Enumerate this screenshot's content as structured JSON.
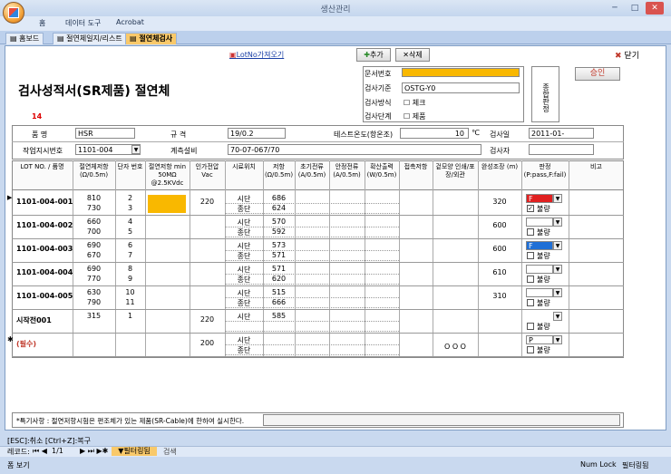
{
  "app": {
    "title": "생산관리",
    "ribbon_tabs": [
      "홈",
      "데이터 도구",
      "Acrobat"
    ]
  },
  "doc_tabs": [
    "홈보드",
    "절연체일지/리스트",
    "절연체검사"
  ],
  "toolbar": {
    "load_link": "LotNo가져오기",
    "add": "추가",
    "delete": "삭제",
    "close": "닫기"
  },
  "approval": {
    "doc_no_label": "문서번호",
    "standard_label": "검사기준",
    "standard_value": "OSTG-Y0",
    "method_label": "검사방식",
    "stage_label": "검사단계",
    "check": "체크",
    "product": "제품",
    "judge_label": "종합판정",
    "approve_btn": "승인"
  },
  "form_title": "검사성적서(SR제품) 절연체",
  "red_number": "14",
  "header": {
    "product_label": "품 명",
    "product": "HSR",
    "spec_label": "규 격",
    "spec": "19/0.2",
    "test_temp_label": "테스트온도(항온조)",
    "temp_value": "10",
    "temp_unit": "℃",
    "date_label": "검사일",
    "date": "2011-01-",
    "work_label": "작업지시번호",
    "work_no": "1101-004",
    "equip_label": "계측설비",
    "equip": "70-07-067/70",
    "inspector_label": "검사자"
  },
  "columns": [
    "LOT NO. / 품명",
    "절연체저항 (Ω/0.5m)",
    "단자 번호",
    "절연저항 min 50MΩ @2.5KVdc",
    "인가전압 Vac",
    "시료위치",
    "저항 (Ω/0.5m)",
    "초기전류 (A/0.5m)",
    "안정전류 (A/0.5m)",
    "확산출력 (W/0.5m)",
    "접촉저항",
    "겉모양 인쇄/포장/외관",
    "완성조장 (m)",
    "판정 (P:pass,F:fail)",
    "비고"
  ],
  "rows": [
    {
      "lot": "1101-004-001",
      "r": [
        "810",
        "730"
      ],
      "t": [
        "2",
        "3"
      ],
      "yellow": true,
      "v": "220",
      "pos": [
        "시단",
        "종단"
      ],
      "ohm": [
        "686",
        "624"
      ],
      "app": "",
      "len": "320",
      "judge": "F",
      "judge_color": "red",
      "bad": "불량",
      "bad_checked": true
    },
    {
      "lot": "1101-004-002",
      "r": [
        "660",
        "700"
      ],
      "t": [
        "4",
        "5"
      ],
      "yellow": false,
      "v": "",
      "pos": [
        "시단",
        "종단"
      ],
      "ohm": [
        "570",
        "592"
      ],
      "app": "",
      "len": "600",
      "judge": "",
      "judge_color": "",
      "bad": "불량",
      "bad_checked": false
    },
    {
      "lot": "1101-004-003",
      "r": [
        "690",
        "670"
      ],
      "t": [
        "6",
        "7"
      ],
      "yellow": false,
      "v": "",
      "pos": [
        "시단",
        "종단"
      ],
      "ohm": [
        "573",
        "571"
      ],
      "app": "",
      "len": "600",
      "judge": "F",
      "judge_color": "blue",
      "bad": "불량",
      "bad_checked": false
    },
    {
      "lot": "1101-004-004",
      "r": [
        "690",
        "770"
      ],
      "t": [
        "8",
        "9"
      ],
      "yellow": false,
      "v": "",
      "pos": [
        "시단",
        "종단"
      ],
      "ohm": [
        "571",
        "620"
      ],
      "app": "",
      "len": "610",
      "judge": "",
      "judge_color": "",
      "bad": "불량",
      "bad_checked": false
    },
    {
      "lot": "1101-004-005",
      "r": [
        "630",
        "790"
      ],
      "t": [
        "10",
        "11"
      ],
      "yellow": false,
      "v": "",
      "pos": [
        "시단",
        "종단"
      ],
      "ohm": [
        "515",
        "666"
      ],
      "app": "",
      "len": "310",
      "judge": "",
      "judge_color": "",
      "bad": "불량",
      "bad_checked": false
    },
    {
      "lot": "시작전001",
      "r": [
        "315",
        ""
      ],
      "t": [
        "1",
        ""
      ],
      "yellow": false,
      "v": "220",
      "pos": [
        "시단",
        ""
      ],
      "ohm": [
        "585",
        ""
      ],
      "app": "",
      "len": "",
      "judge": "",
      "judge_color": "",
      "bad": "불량",
      "bad_checked": false
    },
    {
      "lot": "(필수)",
      "r": [
        "",
        ""
      ],
      "t": [
        "",
        ""
      ],
      "yellow": false,
      "v": "200",
      "pos": [
        "시단",
        "종단"
      ],
      "ohm": [
        "",
        ""
      ],
      "app": "O O O",
      "len": "",
      "judge": "P",
      "judge_color": "",
      "bad": "불량",
      "bad_checked": false
    }
  ],
  "footnote": "*특기사항 : 절연저항시험은 편조체가 있는 제품(SR-Cable)에 한하여 실시한다.",
  "hint": "[ESC]:취소  [Ctrl+Z]:복구",
  "nav": {
    "label": "레코드:",
    "pos": "1/1",
    "filter": "필터링됨",
    "search": "검색"
  },
  "status": {
    "left": "폼 보기",
    "numlock": "Num Lock",
    "filtered": "필터링됨"
  }
}
